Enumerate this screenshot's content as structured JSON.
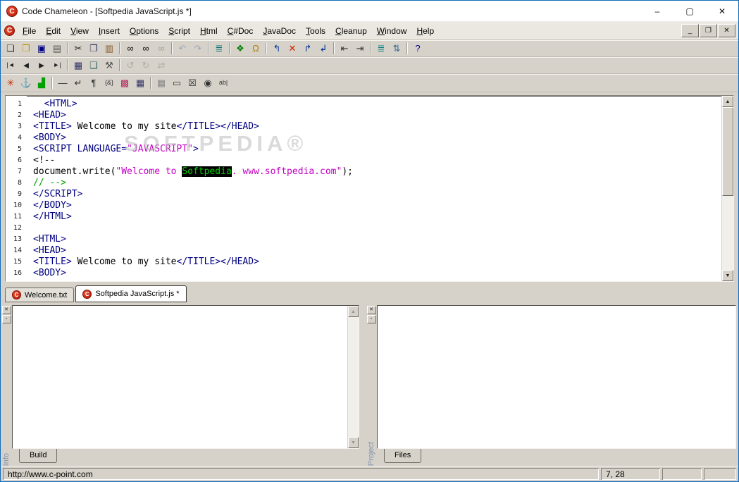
{
  "window": {
    "title": "Code Chameleon - [Softpedia JavaScript.js *]",
    "controls": {
      "minimize": "–",
      "maximize": "▢",
      "close": "✕"
    }
  },
  "icons": {
    "logo": "C",
    "up": "▲",
    "down": "▼",
    "close_small": "✕",
    "pin": "▫"
  },
  "colors": {
    "accent_border": "#0f6cbd",
    "chrome": "#d6d2c9",
    "syntax_tag": "#000080",
    "syntax_string": "#c400c4",
    "syntax_comment": "#00a000",
    "highlight_bg": "#000000",
    "highlight_fg": "#00d000"
  },
  "menubar": {
    "items": [
      "File",
      "Edit",
      "View",
      "Insert",
      "Options",
      "Script",
      "Html",
      "C#Doc",
      "JavaDoc",
      "Tools",
      "Cleanup",
      "Window",
      "Help"
    ],
    "mdi_controls": [
      {
        "name": "mdi-minimize-button",
        "glyph": "_"
      },
      {
        "name": "mdi-restore-button",
        "glyph": "❐"
      },
      {
        "name": "mdi-close-button",
        "glyph": "✕"
      }
    ]
  },
  "toolbars": {
    "row1": [
      {
        "name": "new-document-button",
        "glyph": "❏",
        "color": "#333333"
      },
      {
        "name": "open-file-button",
        "glyph": "❒",
        "color": "#c09000"
      },
      {
        "name": "save-button",
        "glyph": "▣",
        "color": "#000080"
      },
      {
        "name": "print-button",
        "glyph": "▤",
        "color": "#555555"
      },
      {
        "sep": true
      },
      {
        "name": "cut-button",
        "glyph": "✂",
        "color": "#222222"
      },
      {
        "name": "copy-button",
        "glyph": "❐",
        "color": "#333366"
      },
      {
        "name": "paste-button",
        "glyph": "▥",
        "color": "#8a5a2a"
      },
      {
        "sep": true
      },
      {
        "name": "find-button",
        "glyph": "∞",
        "color": "#111111"
      },
      {
        "name": "find-next-button",
        "glyph": "∞",
        "color": "#111111"
      },
      {
        "name": "replace-button",
        "glyph": "∞",
        "color": "#9a968d",
        "disabled": true
      },
      {
        "sep": true
      },
      {
        "name": "undo-button",
        "glyph": "↶",
        "color": "#8fa0b4",
        "disabled": true
      },
      {
        "name": "redo-button",
        "glyph": "↷",
        "color": "#8fa0b4",
        "disabled": true
      },
      {
        "sep": true
      },
      {
        "name": "reformat-button",
        "glyph": "≣",
        "color": "#007070"
      },
      {
        "sep": true
      },
      {
        "name": "compile-script-button",
        "glyph": "❖",
        "color": "#008000"
      },
      {
        "name": "lock-button",
        "glyph": "Ω",
        "color": "#b08000"
      },
      {
        "sep": true
      },
      {
        "name": "goto-previous-mark-button",
        "glyph": "↰",
        "color": "#003399"
      },
      {
        "name": "clear-marks-button",
        "glyph": "✕",
        "color": "#cc2200"
      },
      {
        "name": "goto-next-mark-button",
        "glyph": "↱",
        "color": "#003399"
      },
      {
        "name": "goto-line-button",
        "glyph": "↲",
        "color": "#003399"
      },
      {
        "sep": true
      },
      {
        "name": "indent-decrease-button",
        "glyph": "⇤",
        "color": "#333333"
      },
      {
        "name": "indent-increase-button",
        "glyph": "⇥",
        "color": "#333333"
      },
      {
        "sep": true
      },
      {
        "name": "align-lines-button",
        "glyph": "≣",
        "color": "#008080"
      },
      {
        "name": "renumber-lines-button",
        "glyph": "⇅",
        "color": "#336699"
      },
      {
        "sep": true
      },
      {
        "name": "help-button",
        "glyph": "?",
        "color": "#000099"
      }
    ],
    "row2": [
      {
        "name": "go-first-button",
        "glyph": "|◄",
        "color": "#222222"
      },
      {
        "name": "go-previous-button",
        "glyph": "◄",
        "color": "#222222"
      },
      {
        "name": "go-next-button",
        "glyph": "►",
        "color": "#222222"
      },
      {
        "name": "go-last-button",
        "glyph": "►|",
        "color": "#222222"
      },
      {
        "sep": true
      },
      {
        "name": "grid-view-button",
        "glyph": "▦",
        "color": "#333366"
      },
      {
        "name": "properties-button",
        "glyph": "❑",
        "color": "#336666"
      },
      {
        "name": "tools-build-button",
        "glyph": "⚒",
        "color": "#555555"
      },
      {
        "sep": true
      },
      {
        "name": "refresh-back-button",
        "glyph": "↺",
        "color": "#a8a49b",
        "disabled": true
      },
      {
        "name": "refresh-button",
        "glyph": "↻",
        "color": "#a8a49b",
        "disabled": true
      },
      {
        "name": "swap-view-button",
        "glyph": "⇄",
        "color": "#a8a49b",
        "disabled": true
      }
    ],
    "row3": [
      {
        "name": "spider-button",
        "glyph": "✳",
        "color": "#cc2200"
      },
      {
        "name": "anchor-button",
        "glyph": "⚓",
        "color": "#003366"
      },
      {
        "name": "chart-button",
        "glyph": "▟",
        "color": "#00a000"
      },
      {
        "sep": true
      },
      {
        "name": "horizontal-rule-button",
        "glyph": "—",
        "color": "#333333"
      },
      {
        "name": "line-break-button",
        "glyph": "↵",
        "color": "#333333"
      },
      {
        "name": "paragraph-button",
        "glyph": "¶",
        "color": "#333333"
      },
      {
        "name": "script-block-button",
        "glyph": "{&}",
        "color": "#333333"
      },
      {
        "name": "palette-button",
        "glyph": "▩",
        "color": "#b03060"
      },
      {
        "name": "table-button",
        "glyph": "▦",
        "color": "#333366"
      },
      {
        "sep": true
      },
      {
        "name": "layout-grid-button",
        "glyph": "▦",
        "color": "#888888"
      },
      {
        "name": "button-control-button",
        "glyph": "▭",
        "color": "#333333"
      },
      {
        "name": "checkbox-control-button",
        "glyph": "☒",
        "color": "#333333"
      },
      {
        "name": "radio-control-button",
        "glyph": "◉",
        "color": "#333333"
      },
      {
        "name": "textfield-control-button",
        "glyph": "ab|",
        "color": "#333333"
      }
    ]
  },
  "editor": {
    "watermark": "SOFTPEDIA®",
    "lines": [
      {
        "n": 1,
        "segs": [
          {
            "c": "k",
            "t": "  <HTML>"
          }
        ]
      },
      {
        "n": 2,
        "segs": [
          {
            "c": "k",
            "t": "<HEAD>"
          }
        ]
      },
      {
        "n": 3,
        "segs": [
          {
            "c": "k",
            "t": "<TITLE>"
          },
          {
            "c": "p",
            "t": " Welcome to my site"
          },
          {
            "c": "k",
            "t": "</TITLE></HEAD>"
          }
        ]
      },
      {
        "n": 4,
        "segs": [
          {
            "c": "k",
            "t": "<BODY>"
          }
        ]
      },
      {
        "n": 5,
        "segs": [
          {
            "c": "k",
            "t": "<SCRIPT LANGUAGE="
          },
          {
            "c": "s",
            "t": "\"JAVASCRIPT\""
          },
          {
            "c": "k",
            "t": ">"
          }
        ]
      },
      {
        "n": 6,
        "segs": [
          {
            "c": "p",
            "t": "<!--"
          }
        ]
      },
      {
        "n": 7,
        "segs": [
          {
            "c": "p",
            "t": "document.write("
          },
          {
            "c": "s",
            "t": "\"Welcome to "
          },
          {
            "c": "hl",
            "t": "Softpedia"
          },
          {
            "c": "s",
            "t": ". www.softpedia.com\""
          },
          {
            "c": "p",
            "t": ");"
          }
        ]
      },
      {
        "n": 8,
        "segs": [
          {
            "c": "g",
            "t": "// -->"
          }
        ]
      },
      {
        "n": 9,
        "segs": [
          {
            "c": "k",
            "t": "</SCRIPT>"
          }
        ]
      },
      {
        "n": 10,
        "segs": [
          {
            "c": "k",
            "t": "</BODY>"
          }
        ]
      },
      {
        "n": 11,
        "segs": [
          {
            "c": "k",
            "t": "</HTML>"
          }
        ]
      },
      {
        "n": 12,
        "segs": []
      },
      {
        "n": 13,
        "segs": [
          {
            "c": "k",
            "t": "<HTML>"
          }
        ]
      },
      {
        "n": 14,
        "segs": [
          {
            "c": "k",
            "t": "<HEAD>"
          }
        ]
      },
      {
        "n": 15,
        "segs": [
          {
            "c": "k",
            "t": "<TITLE>"
          },
          {
            "c": "p",
            "t": " Welcome to my site"
          },
          {
            "c": "k",
            "t": "</TITLE></HEAD>"
          }
        ]
      },
      {
        "n": 16,
        "segs": [
          {
            "c": "k",
            "t": "<BODY>"
          }
        ]
      }
    ]
  },
  "doc_tabs": [
    {
      "id": "welcome-txt",
      "label": "Welcome.txt",
      "active": false
    },
    {
      "id": "softpedia-javascript-js",
      "label": "Softpedia JavaScript.js *",
      "active": true
    }
  ],
  "panels": {
    "left": {
      "side_label": "Info",
      "tab": "Build"
    },
    "right": {
      "side_label": "Project",
      "tab": "Files"
    }
  },
  "statusbar": {
    "url": "http://www.c-point.com",
    "position": "7, 28"
  }
}
